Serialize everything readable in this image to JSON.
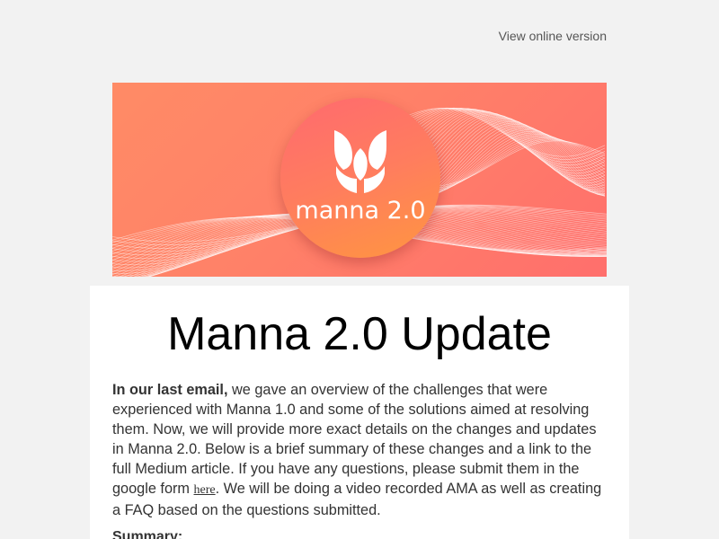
{
  "header": {
    "view_online": "View online version"
  },
  "banner": {
    "logo_text": "manna 2.0",
    "logo_icon": "leaf-sprout-icon",
    "colors": {
      "background_start": "#ff8b66",
      "background_end": "#ff6f6c",
      "circle_top": "#ff6a6f",
      "circle_bottom": "#ff9640"
    }
  },
  "main": {
    "title": "Manna 2.0 Update",
    "intro_bold": "In our last email,",
    "intro_part1": " we gave an overview of the challenges that were experienced with Manna 1.0 and some of the solutions aimed at resolving them. Now, we will provide more exact details on the changes and updates in Manna 2.0. Below is a brief summary of these changes and a link to the full Medium article. If you have any questions, please submit them in the google form ",
    "link_text": "here",
    "intro_part2": ". We will be doing a video recorded AMA as well as creating a FAQ based on the questions submitted.",
    "summary_heading": "Summary:"
  }
}
